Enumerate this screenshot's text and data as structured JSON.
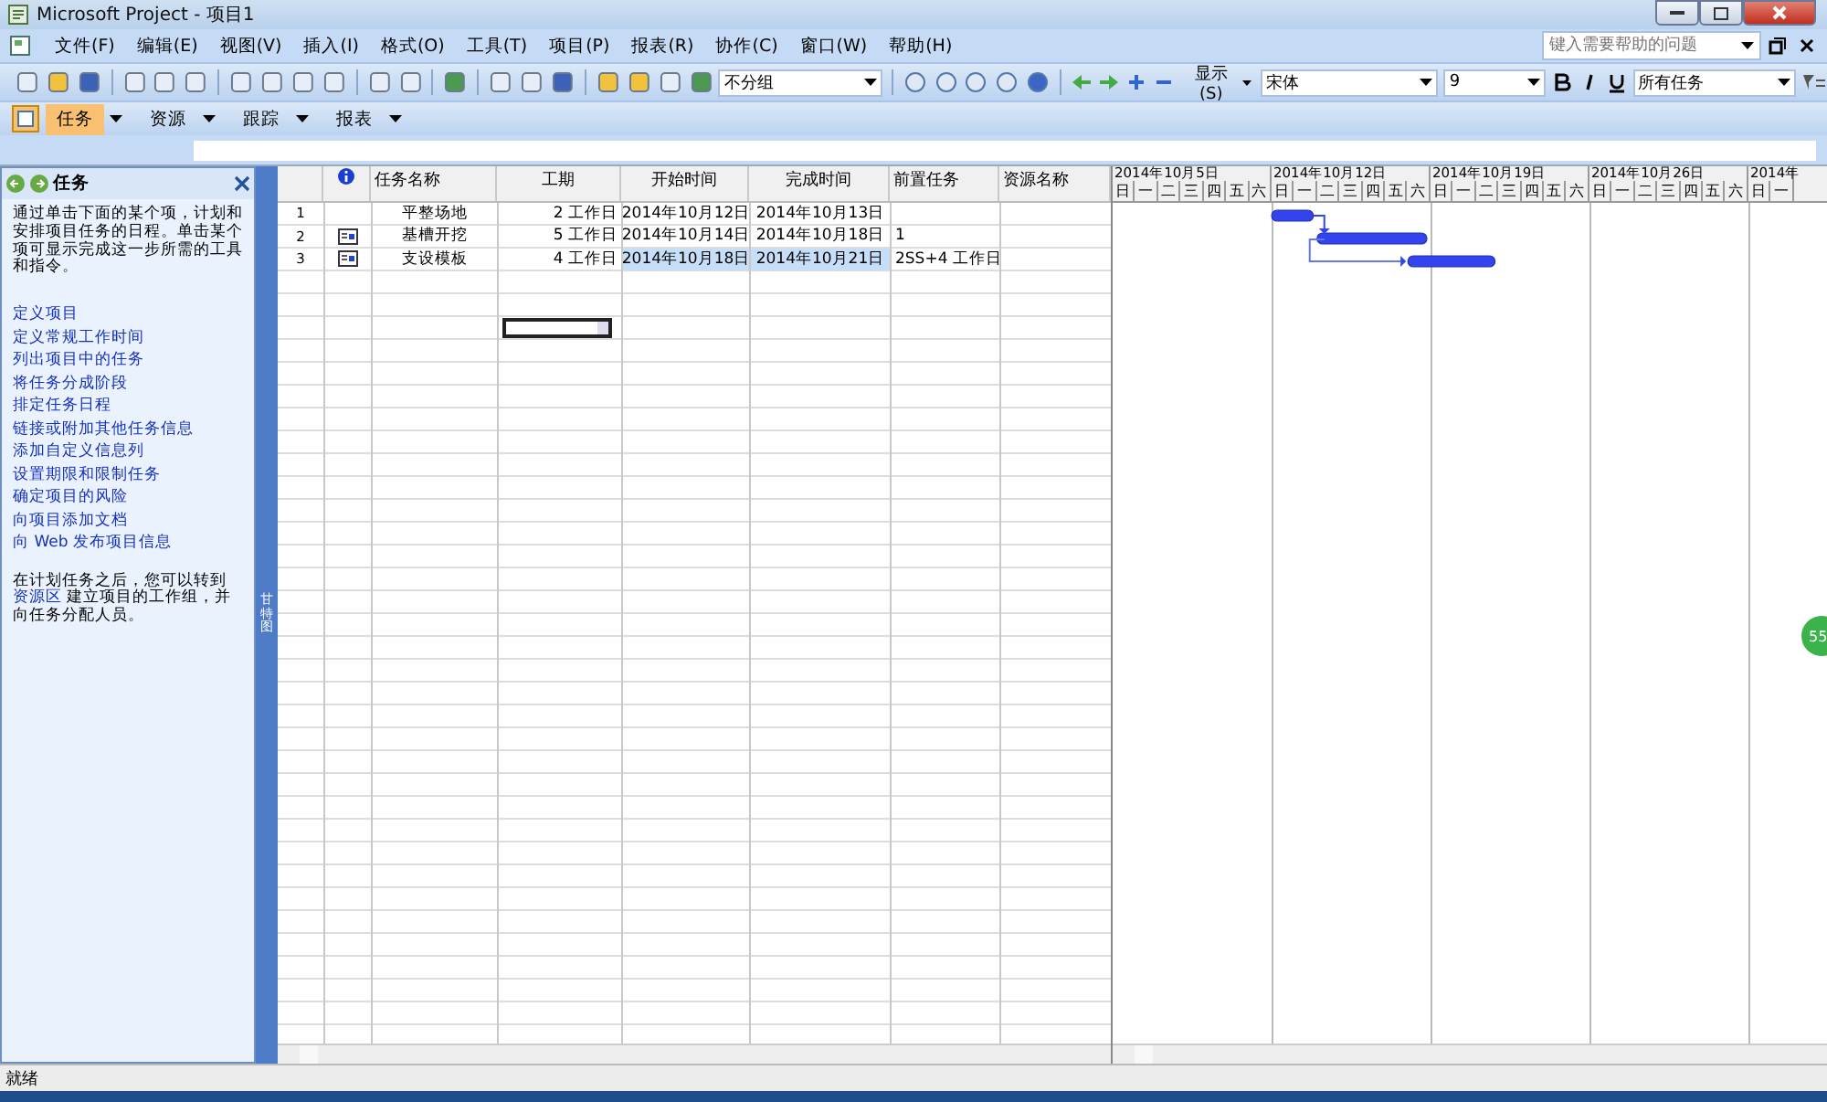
{
  "window": {
    "title": "Microsoft Project - 项目1"
  },
  "menu": [
    "文件(F)",
    "编辑(E)",
    "视图(V)",
    "插入(I)",
    "格式(O)",
    "工具(T)",
    "项目(P)",
    "报表(R)",
    "协作(C)",
    "窗口(W)",
    "帮助(H)"
  ],
  "help_box": {
    "placeholder": "键入需要帮助的问题"
  },
  "toolbar": {
    "group_select": "不分组",
    "show_button": "显示(S)",
    "font_select": "宋体",
    "size_select": "9",
    "filter_select": "所有任务"
  },
  "view_bar": [
    {
      "label": "任务",
      "selected": true
    },
    {
      "label": "资源",
      "selected": false
    },
    {
      "label": "跟踪",
      "selected": false
    },
    {
      "label": "报表",
      "selected": false
    }
  ],
  "task_pane": {
    "title": "任务",
    "intro": "通过单击下面的某个项，计划和安排项目任务的日程。单击某个项可显示完成这一步所需的工具和指令。",
    "links": [
      "定义项目",
      "定义常规工作时间",
      "列出项目中的任务",
      "将任务分成阶段",
      "排定任务日程",
      "链接或附加其他任务信息",
      "添加自定义信息列",
      "设置期限和限制任务",
      "确定项目的风险",
      "向项目添加文档",
      "向 Web 发布项目信息"
    ],
    "footer_before": "在计划任务之后，您可以转到",
    "footer_link": "资源区",
    "footer_after": "建立项目的工作组，并向任务分配人员。"
  },
  "view_label": "甘特图",
  "table": {
    "columns": [
      "任务名称",
      "工期",
      "开始时间",
      "完成时间",
      "前置任务",
      "资源名称"
    ],
    "rows": [
      {
        "id": "1",
        "name": "平整场地",
        "duration": "2 工作日",
        "start": "2014年10月12日",
        "finish": "2014年10月13日",
        "predecessors": "",
        "has_note_icon": false,
        "highlighted": false
      },
      {
        "id": "2",
        "name": "基槽开挖",
        "duration": "5 工作日",
        "start": "2014年10月14日",
        "finish": "2014年10月18日",
        "predecessors": "1",
        "has_note_icon": true,
        "highlighted": false
      },
      {
        "id": "3",
        "name": "支设模板",
        "duration": "4 工作日",
        "start": "2014年10月18日",
        "finish": "2014年10月21日",
        "predecessors": "2SS+4 工作日",
        "has_note_icon": true,
        "highlighted": true
      }
    ]
  },
  "gantt": {
    "weeks": [
      {
        "label": "2014年10月5日",
        "days": [
          "日",
          "一",
          "二",
          "三",
          "四",
          "五",
          "六"
        ]
      },
      {
        "label": "2014年10月12日",
        "days": [
          "日",
          "一",
          "二",
          "三",
          "四",
          "五",
          "六"
        ]
      },
      {
        "label": "2014年10月19日",
        "days": [
          "日",
          "一",
          "二",
          "三",
          "四",
          "五",
          "六"
        ]
      },
      {
        "label": "2014年10月26日",
        "days": [
          "日",
          "一",
          "二",
          "三",
          "四",
          "五",
          "六"
        ]
      },
      {
        "label": "2014年",
        "days": [
          "日",
          "一"
        ]
      }
    ]
  },
  "floating_badge": "55",
  "status_bar": "就绪"
}
